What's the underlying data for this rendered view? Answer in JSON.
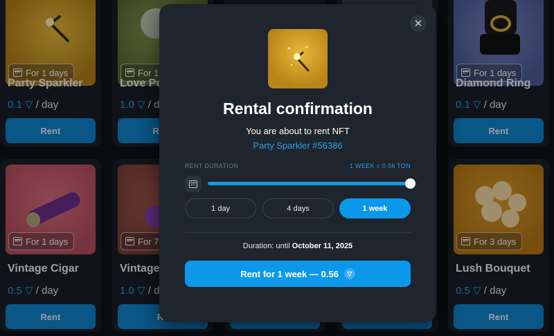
{
  "cards": [
    {
      "name": "Party Sparkler",
      "badge": "For 1 days",
      "price": "0.1",
      "unit": "/ day",
      "rent": "Rent",
      "bg": "#c69221"
    },
    {
      "name": "Love Po",
      "badge": "For 1",
      "price": "1.0",
      "unit": "/ da",
      "rent": "Rent",
      "bg": "#6b7a3a"
    },
    {
      "name": "",
      "badge": "",
      "price": "",
      "unit": "",
      "rent": "",
      "bg": "#1e242b"
    },
    {
      "name": "",
      "badge": "",
      "price": "",
      "unit": "",
      "rent": "",
      "bg": "#2f3540"
    },
    {
      "name": "Diamond Ring",
      "badge": "For 1 days",
      "price": "0.1",
      "unit": "/ day",
      "rent": "Rent",
      "bg": "#5a69a8"
    },
    {
      "name": "Vintage Cigar",
      "badge": "For 1 days",
      "price": "0.5",
      "unit": "/ day",
      "rent": "Rent",
      "bg": "#c45e6e"
    },
    {
      "name": "Vintage",
      "badge": "For 7",
      "price": "1.0",
      "unit": "/ da",
      "rent": "Re",
      "bg": "#8e4c44"
    },
    {
      "name": "",
      "badge": "",
      "price": "",
      "unit": "",
      "rent": "",
      "bg": "#1e242b"
    },
    {
      "name": "",
      "badge": "",
      "price": "",
      "unit": "",
      "rent": "",
      "bg": "#1e242b"
    },
    {
      "name": "Lush Bouquet",
      "badge": "For 3 days",
      "price": "0.5",
      "unit": "/ day",
      "rent": "Rent",
      "bg": "#c8891f"
    }
  ],
  "modal": {
    "close": "✕",
    "title": "Rental confirmation",
    "subtitle": "You are about to rent NFT",
    "nft_name": "Party Sparkler #56386",
    "rent_duration_label": "RENT DURATION",
    "rate": "1 WEEK = 0.56 TON",
    "slider_fraction": 1.0,
    "durations": [
      "1 day",
      "4 days",
      "1 week"
    ],
    "selected_duration": "1 week",
    "duration_prefix": "Duration: until",
    "duration_date": "October 11, 2025",
    "confirm_label": "Rent for 1 week — 0.56",
    "ton_symbol": "▽"
  },
  "colors": {
    "accent": "#0c98ea",
    "link": "#2f9fe2",
    "modal_bg": "#1e252d"
  }
}
